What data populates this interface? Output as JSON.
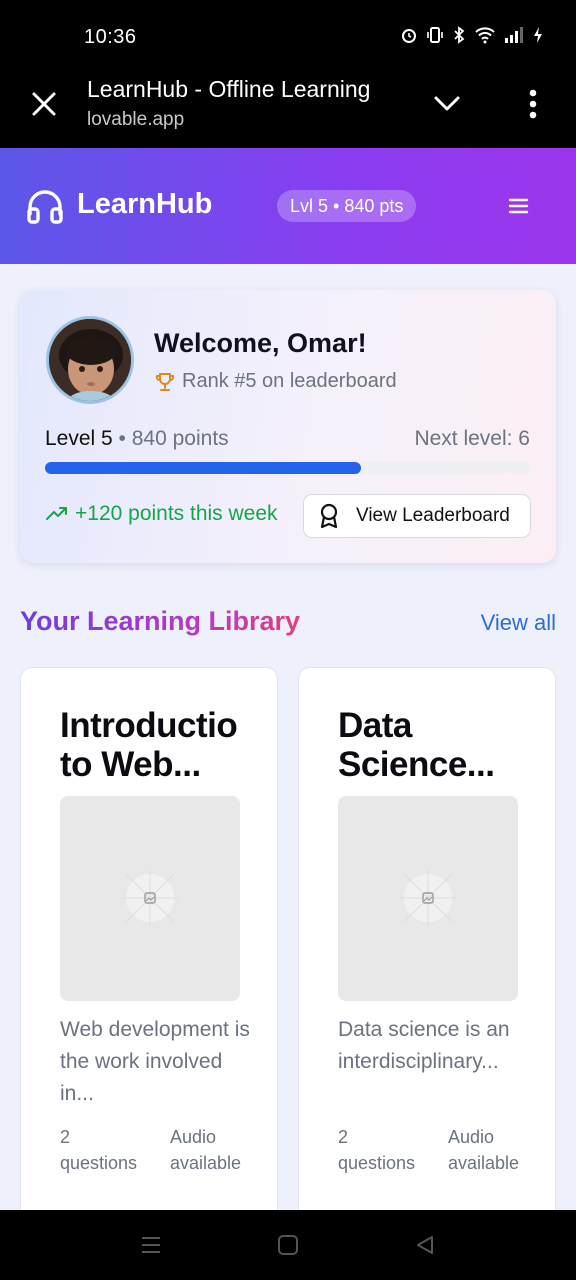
{
  "status": {
    "time": "10:36"
  },
  "browser": {
    "title": "LearnHub - Offline Learning",
    "url": "lovable.app"
  },
  "header": {
    "logo": "LearnHub",
    "level_pill": "Lvl 5 • 840 pts"
  },
  "profile": {
    "welcome": "Welcome, Omar!",
    "rank": "Rank #5 on leaderboard",
    "level": "Level 5",
    "points": " • 840 points",
    "next_level": "Next level: 6",
    "progress": 0.65,
    "weekly": "+120 points this week",
    "leaderboard_button": "View Leaderboard"
  },
  "library": {
    "title": "Your Learning Library",
    "view_all": "View all",
    "courses": [
      {
        "title_line1": "Introductio",
        "title_line2": "to Web...",
        "desc": "Web development is the work involved in...",
        "questions": "2 questions",
        "audio": "Audio available"
      },
      {
        "title_line1": "Data",
        "title_line2": "Science...",
        "desc": "Data science is an interdisciplinary...",
        "questions": "2 questions",
        "audio": "Audio available"
      }
    ]
  },
  "colors": {
    "accent": "#2563eb",
    "header_start": "#5b57e8",
    "header_end": "#9b35ec",
    "success": "#16a34a"
  },
  "icons": [
    "close-icon",
    "chevron-down-icon",
    "more-vert-icon",
    "headphones-icon",
    "menu-icon",
    "trophy-icon",
    "trending-up-icon",
    "award-icon",
    "image-placeholder-icon"
  ]
}
